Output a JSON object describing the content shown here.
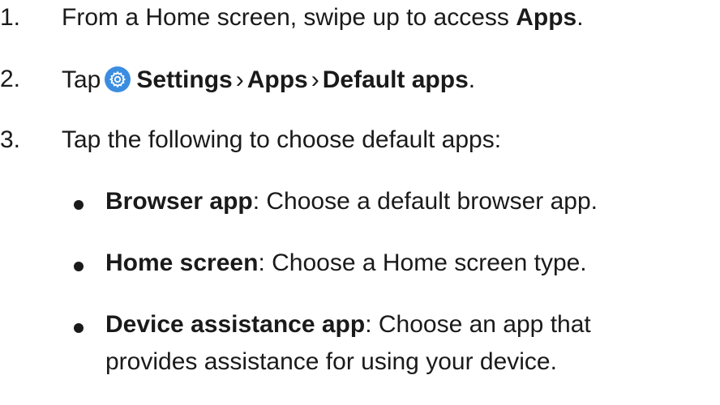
{
  "steps": [
    {
      "number": "1.",
      "text_before": "From a Home screen, swipe up to access ",
      "bold": "Apps",
      "text_after": "."
    },
    {
      "number": "2.",
      "prefix": "Tap",
      "icon": "settings-gear-icon",
      "path": [
        "Settings",
        "Apps",
        "Default apps"
      ],
      "separator": "›",
      "text_after": "."
    },
    {
      "number": "3.",
      "text": "Tap the following to choose default apps:"
    }
  ],
  "bullets": [
    {
      "label": "Browser app",
      "desc": ": Choose a default browser app."
    },
    {
      "label": "Home screen",
      "desc": ": Choose a Home screen type."
    },
    {
      "label": "Device assistance app",
      "desc": ": Choose an app that",
      "desc_line2": "provides assistance for using your device."
    }
  ],
  "colors": {
    "text": "#1a1a1a",
    "icon_bg": "#3b8de0",
    "icon_fg": "#ffffff"
  }
}
